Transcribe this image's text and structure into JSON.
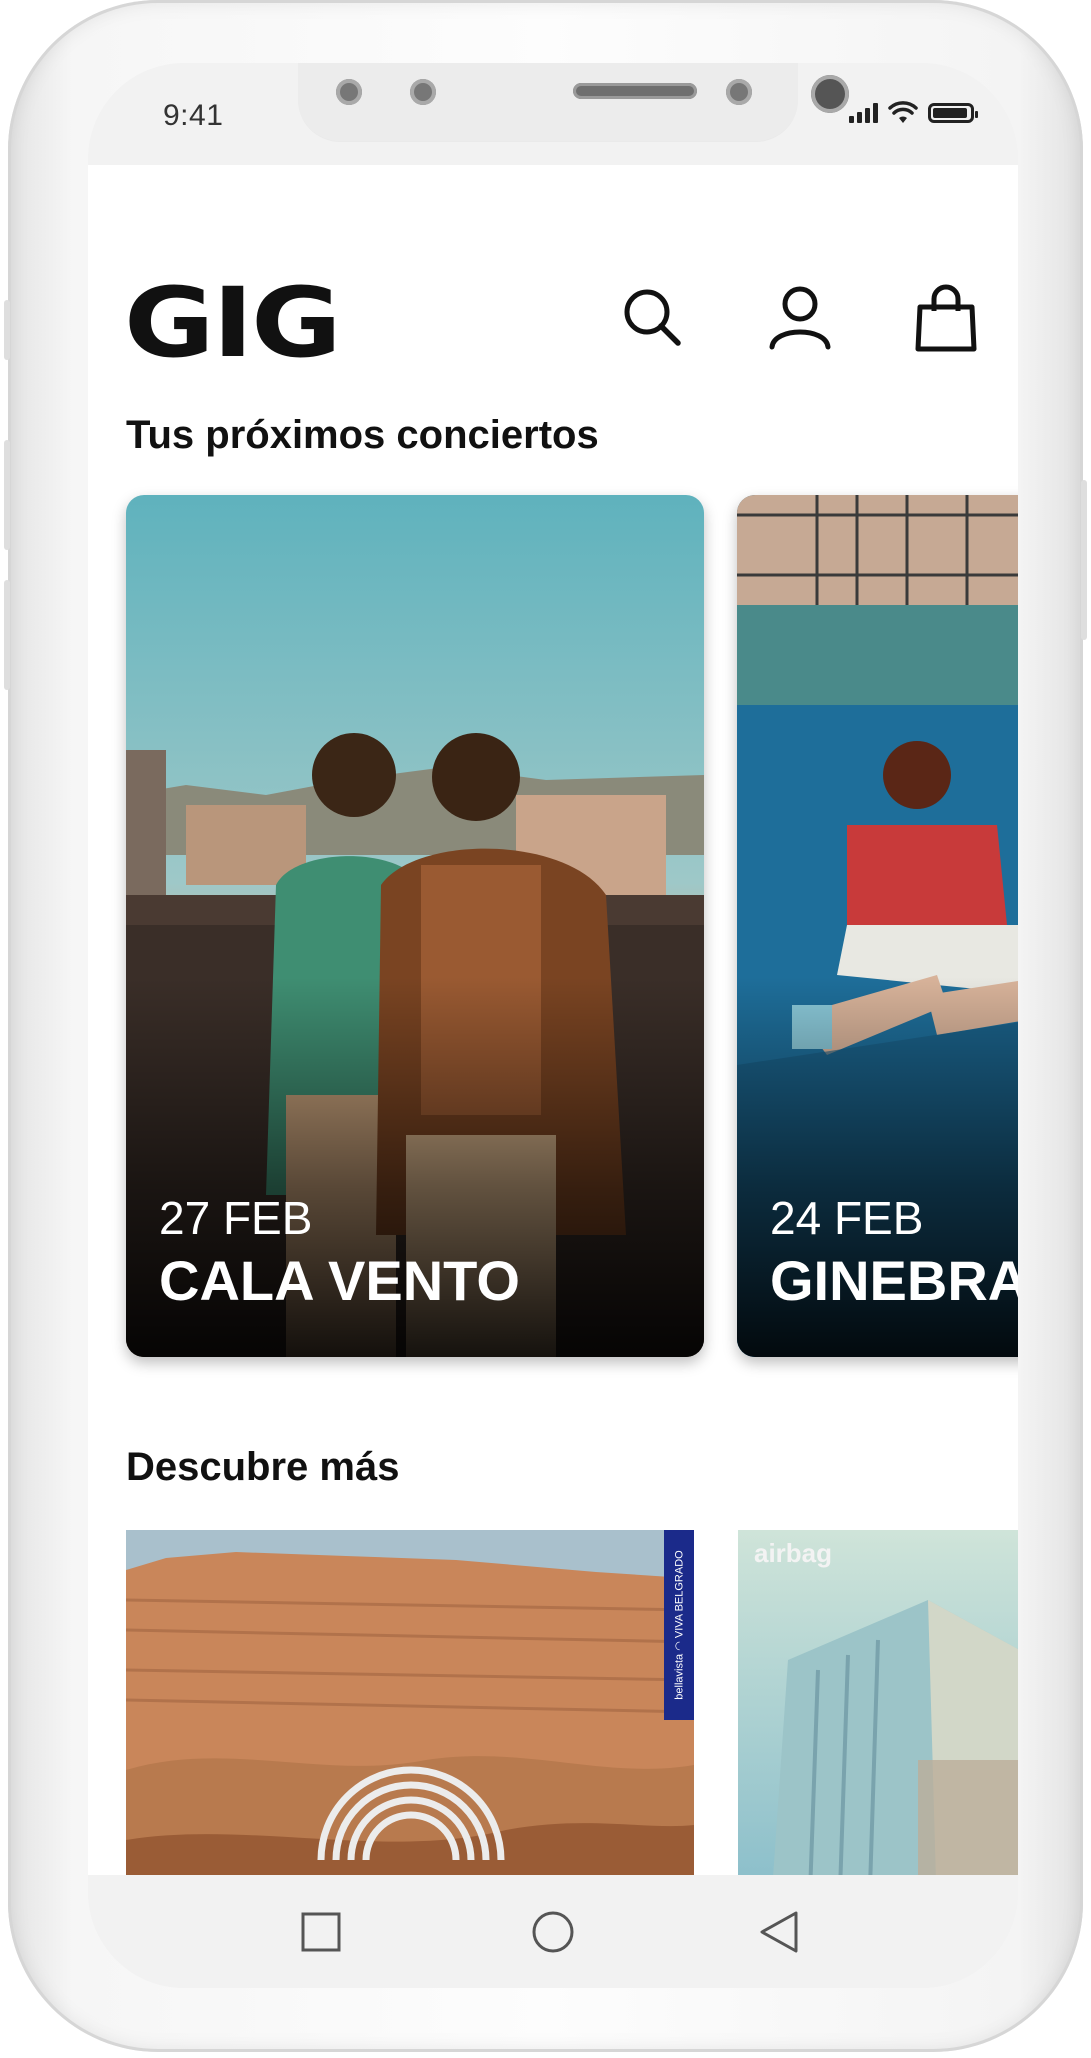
{
  "status_bar": {
    "time": "9:41"
  },
  "header": {
    "logo": "GIG",
    "icons": [
      "search-icon",
      "user-icon",
      "shopping-bag-icon"
    ]
  },
  "upcoming": {
    "title": "Tus próximos conciertos",
    "concerts": [
      {
        "date": "27 FEB",
        "name": "CALA VENTO"
      },
      {
        "date": "24 FEB",
        "name": "GINEBRAS"
      }
    ]
  },
  "discover": {
    "title": "Descubre más",
    "items": [
      {
        "tag": "bellavista ◠ VIVA BELGRADO"
      },
      {
        "label": "airbag"
      }
    ]
  },
  "colors": {
    "text": "#111111",
    "background": "#ffffff",
    "band_tag": "#1b2a8a"
  },
  "navbar": {
    "icons": [
      "square-icon",
      "circle-icon",
      "back-triangle-icon"
    ]
  }
}
